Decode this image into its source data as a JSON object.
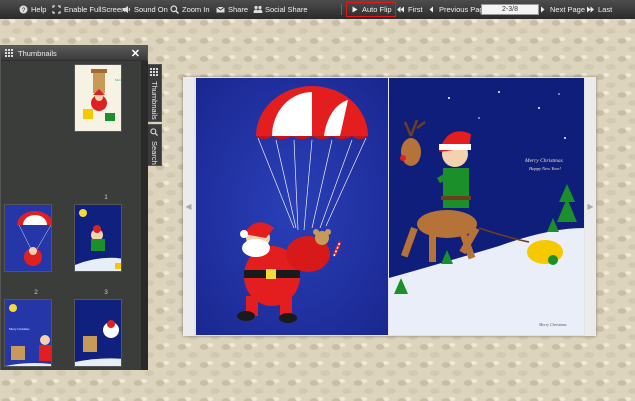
{
  "toolbar": {
    "help": "Help",
    "fullscreen": "Enable FullScreen",
    "sound": "Sound On",
    "zoom": "Zoom In",
    "share": "Share",
    "social_share": "Social Share",
    "auto_flip": "Auto Flip",
    "first": "First",
    "previous": "Previous Page",
    "page_indicator": "2-3/8",
    "next": "Next Page",
    "last": "Last"
  },
  "thumbnails": {
    "title": "Thumbnails",
    "close": "✕",
    "items": [
      {
        "num": "1"
      },
      {
        "num": "2"
      },
      {
        "num": "3"
      },
      {
        "num": "4"
      },
      {
        "num": "5"
      }
    ]
  },
  "side_tabs": {
    "thumbnails": "Thumbnails",
    "search": "Search"
  },
  "book": {
    "right_greeting_line1": "Merry Christmas",
    "right_greeting_line2": "Happy New Year!",
    "right_bottom_text": "Merry Christmas",
    "thumb4_text": "Merry Christmas"
  },
  "colors": {
    "toolbar": "#3a3a3a",
    "accent_highlight": "#e01818",
    "page_blue": "#1f2f9c"
  }
}
